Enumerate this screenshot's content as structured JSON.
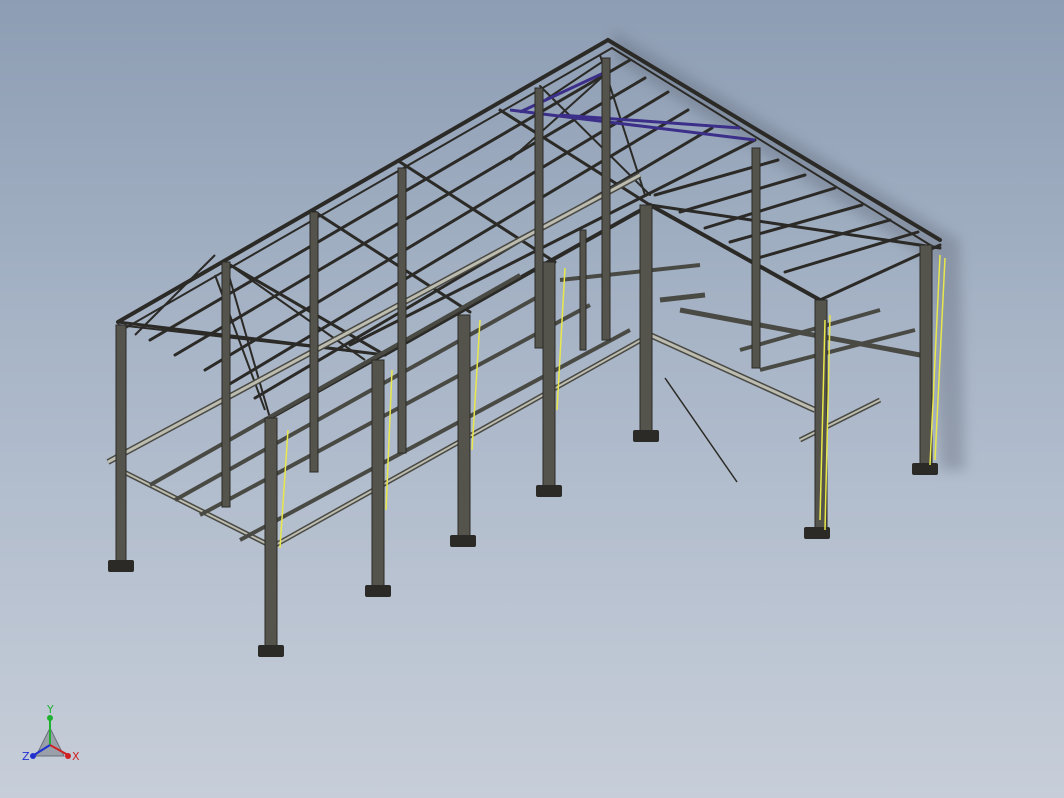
{
  "viewport": {
    "background_top": "#8d9db3",
    "background_bottom": "#c7ced9",
    "model_name": "steel-frame-structure",
    "member_color": "#2b2a26",
    "bracing_color": "#3c2f8a",
    "highlight_color": "#e8e84a"
  },
  "triad": {
    "x_label": "X",
    "y_label": "Y",
    "z_label": "Z",
    "x_color": "#d02020",
    "y_color": "#20b030",
    "z_color": "#2030d0"
  }
}
